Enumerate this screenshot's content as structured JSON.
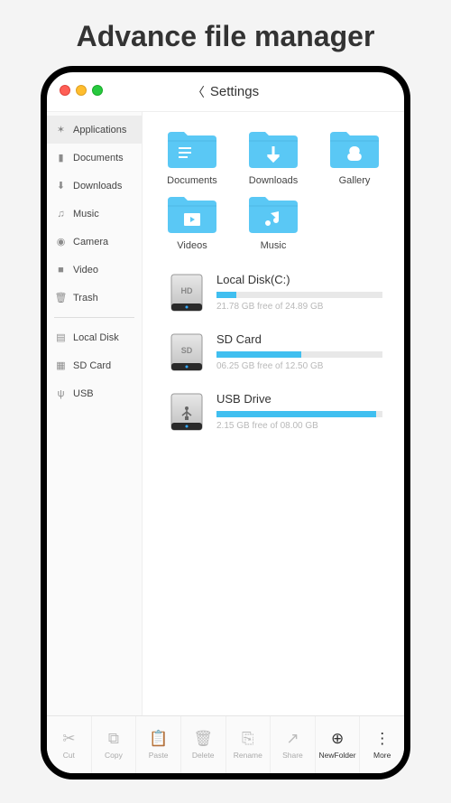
{
  "page_heading": "Advance file manager",
  "header": {
    "title": "Settings"
  },
  "sidebar": {
    "groups": [
      {
        "items": [
          {
            "label": "Applications",
            "icon": "apps",
            "active": true
          },
          {
            "label": "Documents",
            "icon": "doc"
          },
          {
            "label": "Downloads",
            "icon": "download"
          },
          {
            "label": "Music",
            "icon": "music"
          },
          {
            "label": "Camera",
            "icon": "camera"
          },
          {
            "label": "Video",
            "icon": "video"
          },
          {
            "label": "Trash",
            "icon": "trash"
          }
        ]
      },
      {
        "items": [
          {
            "label": "Local Disk",
            "icon": "disk"
          },
          {
            "label": "SD Card",
            "icon": "sd"
          },
          {
            "label": "USB",
            "icon": "usb"
          }
        ]
      }
    ]
  },
  "folders": [
    {
      "label": "Documents",
      "icon": "doc"
    },
    {
      "label": "Downloads",
      "icon": "download"
    },
    {
      "label": "Gallery",
      "icon": "gallery"
    },
    {
      "label": "Videos",
      "icon": "video"
    },
    {
      "label": "Music",
      "icon": "music"
    }
  ],
  "drives": [
    {
      "name": "Local Disk(C:)",
      "label": "HD",
      "percent": 12,
      "stats": "21.78 GB free of 24.89 GB"
    },
    {
      "name": "SD Card",
      "label": "SD",
      "percent": 51,
      "stats": "06.25 GB free of 12.50 GB"
    },
    {
      "name": "USB Drive",
      "label": "USB",
      "percent": 96,
      "stats": "2.15 GB free of 08.00 GB"
    }
  ],
  "toolbar": [
    {
      "label": "Cut",
      "icon": "cut"
    },
    {
      "label": "Copy",
      "icon": "copy"
    },
    {
      "label": "Paste",
      "icon": "paste"
    },
    {
      "label": "Delete",
      "icon": "delete"
    },
    {
      "label": "Rename",
      "icon": "rename"
    },
    {
      "label": "Share",
      "icon": "share"
    },
    {
      "label": "NewFolder",
      "icon": "newfolder",
      "dark": true
    },
    {
      "label": "More",
      "icon": "more",
      "dark": true
    }
  ]
}
